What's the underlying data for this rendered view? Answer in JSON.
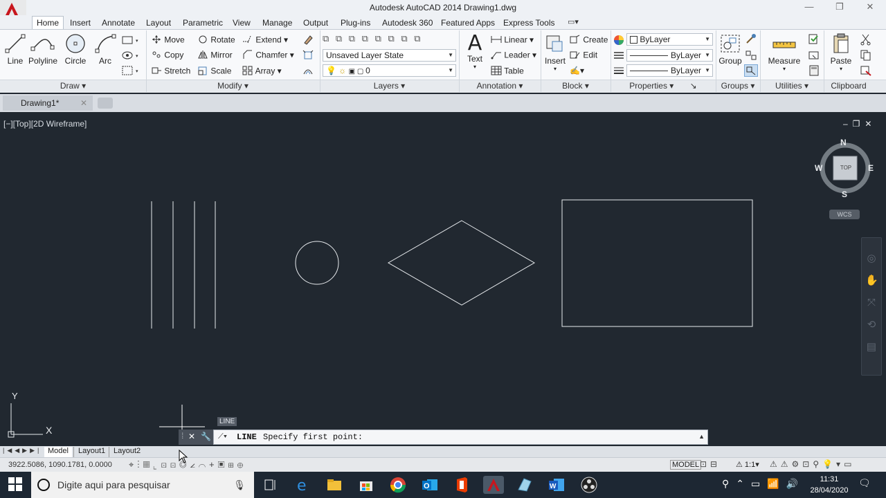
{
  "window": {
    "title": "Autodesk AutoCAD 2014    Drawing1.dwg",
    "min": "—",
    "max": "❐",
    "close": "✕"
  },
  "menu_tabs": [
    "Home",
    "Insert",
    "Annotate",
    "Layout",
    "Parametric",
    "View",
    "Manage",
    "Output",
    "Plug-ins",
    "Autodesk 360",
    "Featured Apps",
    "Express Tools"
  ],
  "draw": {
    "line": "Line",
    "polyline": "Polyline",
    "circle": "Circle",
    "arc": "Arc"
  },
  "modify": {
    "move": "Move",
    "rotate": "Rotate",
    "extend": "Extend",
    "copy": "Copy",
    "mirror": "Mirror",
    "chamfer": "Chamfer",
    "stretch": "Stretch",
    "scale": "Scale",
    "array": "Array"
  },
  "layers": {
    "state": "Unsaved Layer State",
    "current": "0"
  },
  "annotation": {
    "text": "Text",
    "linear": "Linear",
    "leader": "Leader",
    "table": "Table"
  },
  "block": {
    "insert": "Insert",
    "create": "Create",
    "edit": "Edit"
  },
  "properties": {
    "color": "ByLayer",
    "linetype": "ByLayer",
    "lineweight": "ByLayer"
  },
  "groups": {
    "group": "Group"
  },
  "utilities": {
    "measure": "Measure"
  },
  "clipboard": {
    "paste": "Paste"
  },
  "panels": {
    "draw": "Draw",
    "modify": "Modify",
    "layers": "Layers",
    "annotation": "Annotation",
    "block": "Block",
    "properties": "Properties",
    "groups": "Groups",
    "utilities": "Utilities",
    "clipboard": "Clipboard"
  },
  "file_tab": "Drawing1*",
  "viewport_label": "[−][Top][2D Wireframe]",
  "viewcube": {
    "n": "N",
    "s": "S",
    "e": "E",
    "w": "W",
    "top": "TOP",
    "wcs": "WCS"
  },
  "ucs": {
    "x": "X",
    "y": "Y"
  },
  "command": {
    "hint": "LINE",
    "name": "LINE",
    "prompt": "Specify first point:"
  },
  "layout_tabs": [
    "Model",
    "Layout1",
    "Layout2"
  ],
  "status": {
    "coords": "3922.5086, 1090.1781, 0.0000",
    "model": "MODEL",
    "scale": "1:1"
  },
  "taskbar": {
    "search": "Digite aqui para pesquisar",
    "time": "11:31",
    "date": "28/04/2020"
  }
}
